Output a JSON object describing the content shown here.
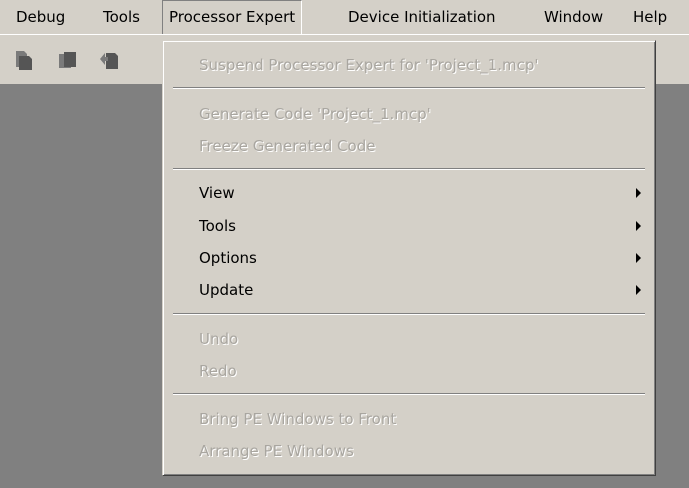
{
  "menubar": {
    "items": [
      {
        "label": "Debug"
      },
      {
        "label": "Tools"
      },
      {
        "label": "Processor Expert"
      },
      {
        "label": "Device Initialization"
      },
      {
        "label": "Window"
      },
      {
        "label": "Help"
      }
    ]
  },
  "toolbar": {
    "icons": [
      "page-icon",
      "page-stack-icon",
      "page-arrow-icon"
    ]
  },
  "dropdown": {
    "suspend": "Suspend Processor Expert for 'Project_1.mcp'",
    "generate": "Generate Code 'Project_1.mcp'",
    "freeze": "Freeze Generated Code",
    "view": "View",
    "tools": "Tools",
    "options": "Options",
    "update": "Update",
    "undo": "Undo",
    "redo": "Redo",
    "bring_front": "Bring PE Windows to Front",
    "arrange": "Arrange PE Windows"
  },
  "colors": {
    "menu_bg": "#d4d0c8",
    "workspace": "#808080",
    "disabled_text": "#a9a6a0"
  }
}
